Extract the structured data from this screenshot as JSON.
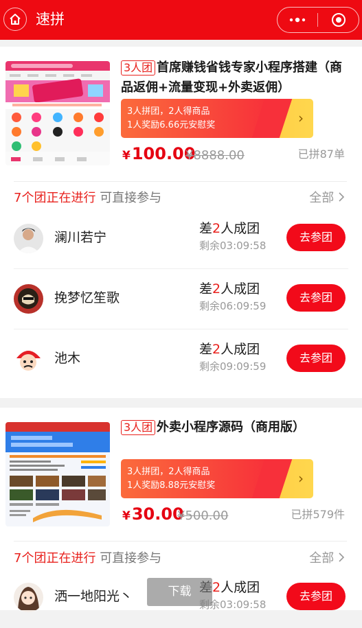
{
  "header": {
    "title": "速拼"
  },
  "products": [
    {
      "team_tag": "3人团",
      "title": "首席赚钱省钱专家小程序搭建（商品返佣+流量变现+外卖返佣）",
      "banner": {
        "line1": "3人拼团，2人得商品",
        "line2": "1人奖励6.66元安慰奖",
        "arrow": "›"
      },
      "yen": "¥",
      "price": "100.00",
      "original_price": "¥8888.00",
      "sold": "已拼87单",
      "ongoing": {
        "red": "7个团正在进行",
        "gray": "可直接参与"
      },
      "all_label": "全部",
      "groups": [
        {
          "name": "澜川若宁",
          "need_prefix": "差",
          "need_num": "2",
          "need_suffix": "人成团",
          "remain": "剩余03:09:58",
          "button": "去参团"
        },
        {
          "name": "挽梦忆笙歌",
          "need_prefix": "差",
          "need_num": "2",
          "need_suffix": "人成团",
          "remain": "剩余06:09:59",
          "button": "去参团"
        },
        {
          "name": "池木",
          "need_prefix": "差",
          "need_num": "2",
          "need_suffix": "人成团",
          "remain": "剩余09:09:59",
          "button": "去参团"
        }
      ]
    },
    {
      "team_tag": "3人团",
      "title": "外卖小程序源码（商用版）",
      "banner": {
        "line1": "3人拼团，2人得商品",
        "line2": "1人奖励8.88元安慰奖",
        "arrow": "›"
      },
      "yen": "¥",
      "price": "30.00",
      "original_price": "¥500.00",
      "sold": "已拼579件",
      "ongoing": {
        "red": "7个团正在进行",
        "gray": "可直接参与"
      },
      "all_label": "全部",
      "groups": [
        {
          "name": "洒一地阳光丶",
          "need_prefix": "差",
          "need_num": "2",
          "need_suffix": "人成团",
          "remain": "剩余03:09:58",
          "button": "去参团"
        }
      ]
    }
  ],
  "download_label": "下载",
  "colors": {
    "brand_red": "#ee0a12",
    "price_red": "#e50011",
    "banner_yellow": "#ffd74e"
  }
}
